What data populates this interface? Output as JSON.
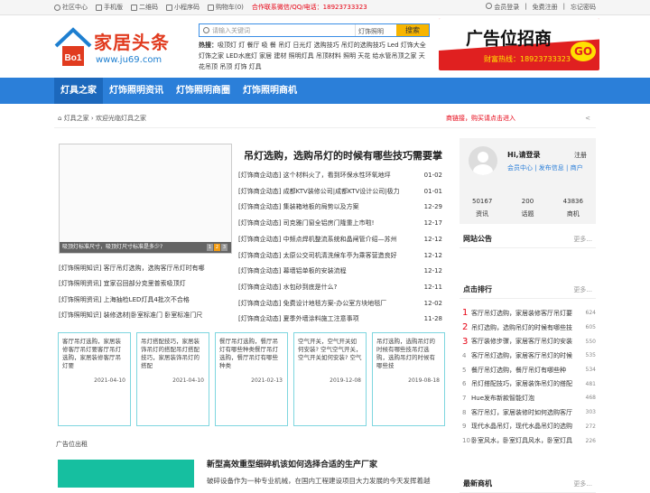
{
  "topbar": {
    "left": [
      "社区中心",
      "手机版",
      "二维码",
      "小程序码",
      "购物车(0)"
    ],
    "contact": "合作联系微信/QQ/电话：18923733323",
    "right": [
      "会员登录",
      "免费注册",
      "忘记密码"
    ]
  },
  "logo": {
    "name": "家居头条",
    "url": "www.ju69.com",
    "badge": "Bo1"
  },
  "search": {
    "placeholder": "请输入关键词",
    "select": "灯饰照明",
    "button": "搜索"
  },
  "hot": {
    "label": "热搜：",
    "text": "吸顶灯 灯 餐厅 吸 餐 吊灯 日光灯 选购技巧 吊灯的选购技巧 Led 灯饰大全 灯饰之家 LED水底灯 家居 建材 照明灯具 吊顶材料 照明 天花 给水管吊顶之家 天花吊顶 吊顶 灯饰 灯具"
  },
  "ad_top": {
    "title": "广告位招商",
    "hotline": "财富热线：18923733323",
    "go": "GO"
  },
  "nav": [
    "灯具之家",
    "灯饰照明资讯",
    "灯饰照明商圈",
    "灯饰照明商机"
  ],
  "breadcrumb": {
    "home": "灯具之家",
    "welcome": "欢迎光临灯具之家",
    "notice": "商链接，购买请点击进入"
  },
  "featured": {
    "caption": "吸顶灯标准尺寸，吸顶灯尺寸标准是多少?",
    "dots": [
      "1",
      "2",
      "3"
    ]
  },
  "left_list": [
    "[灯饰照明知识] 客厅吊灯选购，选购客厅吊灯时有哪",
    "[灯饰照明资讯] 宜家召回部分克里普索吸顶灯",
    "[灯饰照明资讯] 上海抽检LED灯具4批次不合格",
    "[灯饰照明知识] 装修选材|卧室标准门 卧室标准门尺"
  ],
  "headline": "吊灯选购，选购吊灯的时候有哪些技巧需要掌",
  "news": [
    {
      "t": "[灯饰商企动态] 这个材料火了，看到环保水性环氧地坪",
      "d": "01-02"
    },
    {
      "t": "[灯饰商企动态] 成都KTV装修公司|成都KTV设计公司|极力",
      "d": "01-01"
    },
    {
      "t": "[灯饰商企动态] 集装箱地板的局势以及方案",
      "d": "12-29"
    },
    {
      "t": "[灯饰商企动态] 司克雅门窗全铝房门隆重上市啦!",
      "d": "12-17"
    },
    {
      "t": "[灯饰商企动态] 中频点焊机整流系统和晶闸管介绍—苏州",
      "d": "12-12"
    },
    {
      "t": "[灯饰商企动态] 太原公交司机清洗候车亭为乘客营造良好",
      "d": "12-12"
    },
    {
      "t": "[灯饰商企动态] 幕墙铝单板的安装流程",
      "d": "12-12"
    },
    {
      "t": "[灯饰商企动态] 水包砂到底是什么?",
      "d": "12-11"
    },
    {
      "t": "[灯饰商企动态] 免费设计地毯方案-办公室方块地毯厂",
      "d": "12-02"
    },
    {
      "t": "[灯饰商企动态] 夏季外墙涂料施工注意事项",
      "d": "11-28"
    }
  ],
  "cards": [
    {
      "title": "客厅吊灯选购，家居装修客厅吊灯要客厅吊灯选购，家居装修客厅吊灯要",
      "date": "2021-04-10"
    },
    {
      "title": "吊灯搭配技巧，家居装饰吊灯的搭配吊灯搭配技巧，家居装饰吊灯的搭配",
      "date": "2021-04-10"
    },
    {
      "title": "餐厅吊灯选购，餐厅吊灯有哪些种类餐厅吊灯选购，餐厅吊灯有哪些种类",
      "date": "2021-02-13"
    },
    {
      "title": "空气开关，空气开关如何安装? 空气空气开关，空气开关如何安装? 空气",
      "date": "2019-12-08"
    },
    {
      "title": "吊灯选购，选购吊灯的时候有哪些技吊灯选购，选购吊灯的时候有哪些技",
      "date": "2019-08-18"
    }
  ],
  "ad_low": "广告位出租",
  "bottom": {
    "title": "新型高效重型细碎机该如何选择合适的生产厂家",
    "desc": "破碎设备作为一种专业机械，在国内工程建设项目大力发展的今天发挥着越"
  },
  "user": {
    "hello": "Hi,请登录",
    "register": "注册",
    "links": "会员中心 | 发布信息 | 商户",
    "stats": [
      {
        "n": "50167",
        "l": "资讯"
      },
      {
        "n": "200",
        "l": "话题"
      },
      {
        "n": "43836",
        "l": "商机"
      }
    ]
  },
  "sections": {
    "notice": "网站公告",
    "rank": "点击排行",
    "latest": "最新商机",
    "more": "更多..."
  },
  "rank": [
    {
      "n": "1",
      "t": "客厅吊灯选购，家居装修客厅吊灯要",
      "c": "624"
    },
    {
      "n": "2",
      "t": "吊灯选购，选购吊灯的时候有哪些技",
      "c": "605"
    },
    {
      "n": "3",
      "t": "客厅装修步骤，家居客厅吊灯的安装",
      "c": "550"
    },
    {
      "n": "4",
      "t": "客厅吊灯选购，家居客厅吊灯的时候",
      "c": "535"
    },
    {
      "n": "5",
      "t": "餐厅吊灯选购，餐厅吊灯有哪些种",
      "c": "534"
    },
    {
      "n": "6",
      "t": "吊灯搭配技巧，家居装饰吊灯的搭配",
      "c": "481"
    },
    {
      "n": "7",
      "t": "Hue发布新款智能灯泡",
      "c": "468"
    },
    {
      "n": "8",
      "t": "客厅吊灯，家居装修时如何选购客厅",
      "c": "303"
    },
    {
      "n": "9",
      "t": "现代水晶吊灯，现代水晶吊灯的选购",
      "c": "272"
    },
    {
      "n": "10",
      "t": "卧室风水，卧室灯具风水，卧室灯具",
      "c": "226"
    }
  ],
  "colors": {
    "nav": "#2b7fd9",
    "accent_red": "#e60012",
    "card_border": "#7ed6df",
    "green": "#16bfa0"
  }
}
